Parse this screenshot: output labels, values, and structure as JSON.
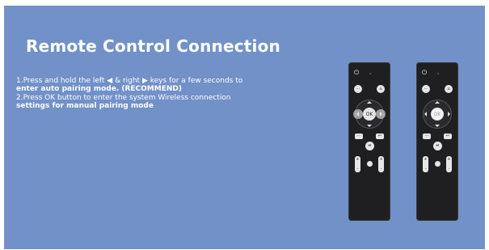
{
  "heading": "Remote Control Connection",
  "instructions": {
    "line1_a": "1.Press and hold the left ",
    "left_triangle": "◀",
    "line1_b": " & right ",
    "right_triangle": "▶",
    "line1_c": " keys for a few seconds to",
    "line2": "enter auto pairing mode. (RECOMMEND)",
    "line3": "2.Press OK button to enter the system Wireless connection",
    "line4": "settings for manual pairing mode"
  },
  "remote": {
    "ok_label": "OK",
    "power_icon": "⏻",
    "menu_icon": "⋯",
    "home_icon": "⌂",
    "play_icon": "⏯",
    "back_icon": "↩",
    "mute_icon": "🔇"
  },
  "colors": {
    "background": "#7191c8",
    "remote_body": "#1f1f22",
    "text": "#ffffff"
  }
}
